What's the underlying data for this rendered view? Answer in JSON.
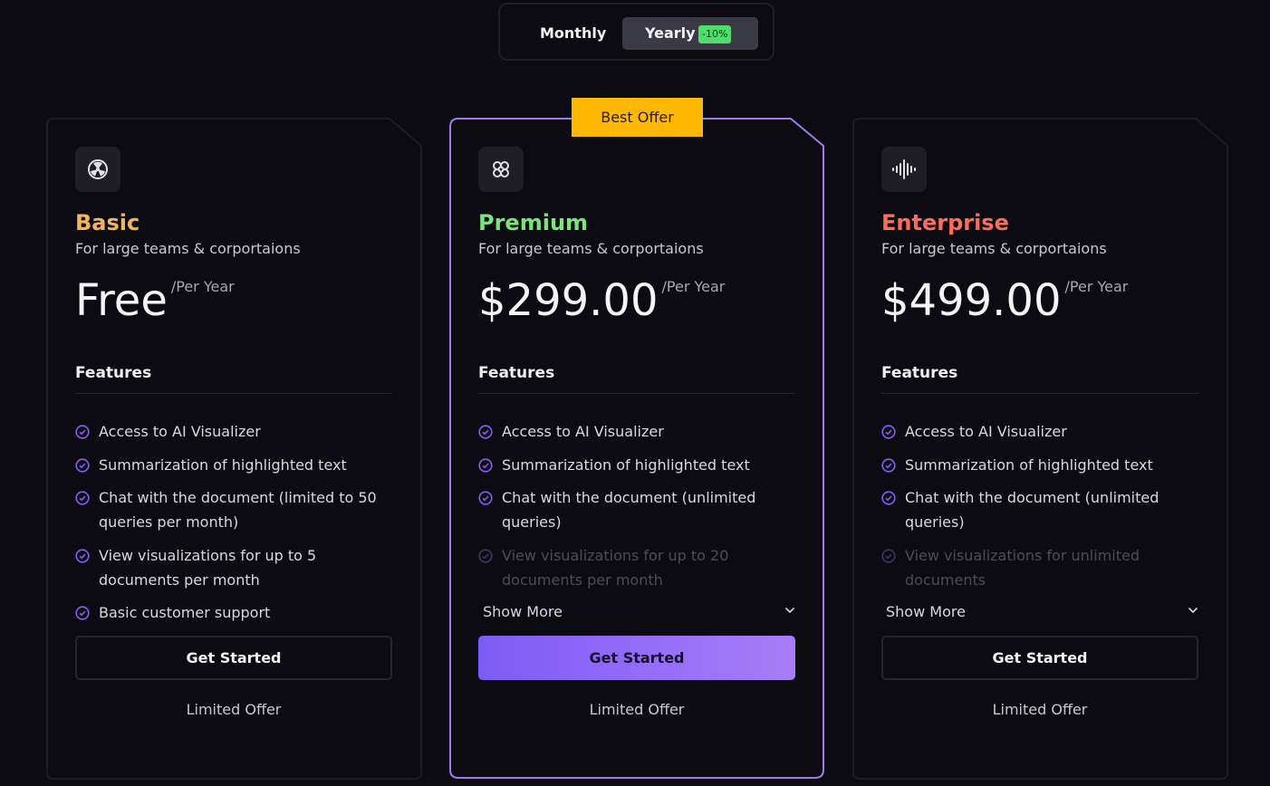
{
  "billing_toggle": {
    "monthly": "Monthly",
    "yearly": "Yearly",
    "yearly_discount": "-10%",
    "selected": "Yearly"
  },
  "best_offer": "Best Offer",
  "colors": {
    "basic": "#f5b35e",
    "premium": "#7be37a",
    "enterprise": "#ff6b5c",
    "check": "#8b5cf6",
    "best_badge": "#ffb800"
  },
  "plans": [
    {
      "name": "Basic",
      "icon": "radiation-icon",
      "description": "For large teams & corportaions",
      "price": "Free",
      "period": "/Per Year",
      "features_heading": "Features",
      "features": [
        "Access to AI Visualizer",
        "Summarization of highlighted text",
        "Chat with the document (limited to 50 queries per month)",
        "View visualizations for up to 5 documents per month",
        "Basic customer support"
      ],
      "cta": "Get Started",
      "limited": "Limited Offer"
    },
    {
      "name": "Premium",
      "icon": "flower-icon",
      "description": "For large teams & corportaions",
      "price": "$299.00",
      "period": "/Per Year",
      "features_heading": "Features",
      "features": [
        "Access to AI Visualizer",
        "Summarization of highlighted text",
        "Chat with the document (unlimited queries)",
        "View visualizations for up to 20 documents per month"
      ],
      "show_more": "Show More",
      "cta": "Get Started",
      "limited": "Limited Offer"
    },
    {
      "name": "Enterprise",
      "icon": "soundwave-icon",
      "description": "For large teams & corportaions",
      "price": "$499.00",
      "period": "/Per Year",
      "features_heading": "Features",
      "features": [
        "Access to AI Visualizer",
        "Summarization of highlighted text",
        "Chat with the document (unlimited queries)",
        "View visualizations for unlimited documents"
      ],
      "show_more": "Show More",
      "cta": "Get Started",
      "limited": "Limited Offer"
    }
  ]
}
